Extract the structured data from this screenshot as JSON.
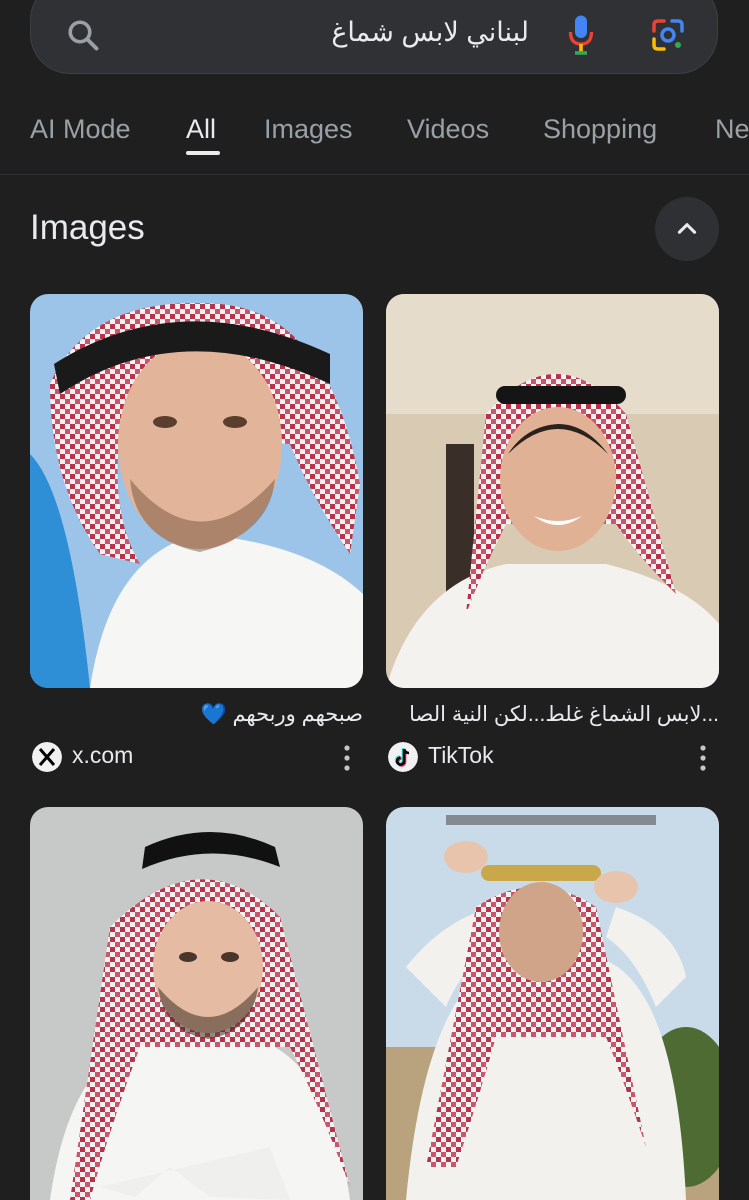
{
  "search": {
    "query": "لبناني لابس شماغ"
  },
  "tabs": [
    {
      "label": "AI Mode",
      "active": false
    },
    {
      "label": "All",
      "active": true
    },
    {
      "label": "Images",
      "active": false
    },
    {
      "label": "Videos",
      "active": false
    },
    {
      "label": "Shopping",
      "active": false
    },
    {
      "label": "Ne",
      "active": false
    }
  ],
  "images_section": {
    "title": "Images",
    "results": [
      {
        "caption": "صبحهم وربحهم",
        "caption_emoji": "💙",
        "source": "x.com",
        "favicon": "x-logo-icon"
      },
      {
        "caption": "...لابس الشماغ غلط...لكن النية الصا",
        "source": "TikTok",
        "favicon": "tiktok-logo-icon"
      },
      {
        "caption": "",
        "source": ""
      },
      {
        "caption": "",
        "source": ""
      }
    ]
  },
  "colors": {
    "background": "#1f1f1f",
    "search_bg": "#303134",
    "text": "#e8eaed",
    "muted": "#9aa0a6",
    "keffiyeh_red": "#b8324a"
  }
}
